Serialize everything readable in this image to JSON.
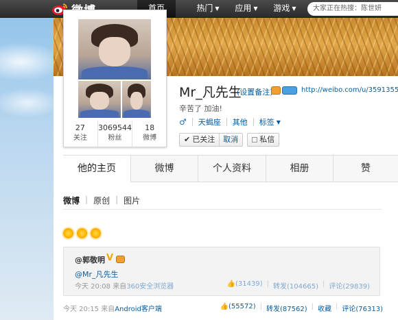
{
  "topbar": {
    "logo_text": "微博",
    "nav": [
      {
        "label": "首页"
      },
      {
        "label": "热门",
        "has_caret": true
      },
      {
        "label": "应用",
        "has_caret": true
      },
      {
        "label": "游戏",
        "has_caret": true
      }
    ],
    "search_placeholder": "大家正在热搜：陈世妍"
  },
  "profile": {
    "name": "Mr_凡先生",
    "remark_link": "(设置备注)",
    "url": "http://weibo.com/u/3591355593",
    "bio": "辛苦了 加油!",
    "gender_icon": "male-icon",
    "tags": [
      "天蝎座",
      "其他",
      "标签"
    ],
    "follow_btn": "已关注",
    "unfollow": "取消",
    "message_btn": "私信",
    "stats": [
      {
        "num": "27",
        "label": "关注"
      },
      {
        "num": "3069544",
        "label": "粉丝"
      },
      {
        "num": "18",
        "label": "微博"
      }
    ]
  },
  "tabs": [
    "他的主页",
    "微博",
    "个人资料",
    "相册",
    "赞"
  ],
  "subtabs": [
    "微博",
    "原创",
    "图片"
  ],
  "feed": {
    "emoji": [
      "sun-icon",
      "sun-icon",
      "sun-icon"
    ],
    "repost": {
      "user": "@郭敬明",
      "badge": "V",
      "text": "@Mr_凡先生",
      "time": "今天 20:08",
      "from_label": "来自",
      "source": "360安全浏览器",
      "likes": "(31439)",
      "reposts": "转发(104665)",
      "comments": "评论(29839)"
    },
    "post": {
      "time": "今天 20:15",
      "from_label": "来自",
      "source": "Android客户端",
      "likes": "(55572)",
      "reposts": "转发(87562)",
      "favorite": "收藏",
      "comments": "评论(76313)"
    }
  },
  "colors": {
    "link": "#0a5b9c",
    "topbar": "#2c2c2c",
    "banner": "#d9a04a"
  }
}
